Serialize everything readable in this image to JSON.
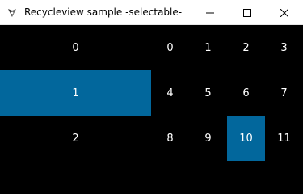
{
  "window": {
    "title": "Recycleview sample -selectable-",
    "icon": "kivy-app-icon",
    "buttons": [
      "minimize-icon",
      "maximize-icon",
      "close-icon"
    ]
  },
  "left_list": {
    "items": [
      {
        "label": "0",
        "selected": false
      },
      {
        "label": "1",
        "selected": true
      },
      {
        "label": "2",
        "selected": false
      }
    ]
  },
  "grid": {
    "items": [
      {
        "label": "0",
        "selected": false
      },
      {
        "label": "1",
        "selected": false
      },
      {
        "label": "2",
        "selected": false
      },
      {
        "label": "3",
        "selected": false
      },
      {
        "label": "4",
        "selected": false
      },
      {
        "label": "5",
        "selected": false
      },
      {
        "label": "6",
        "selected": false
      },
      {
        "label": "7",
        "selected": false
      },
      {
        "label": "8",
        "selected": false
      },
      {
        "label": "9",
        "selected": false
      },
      {
        "label": "10",
        "selected": true
      },
      {
        "label": "11",
        "selected": false
      }
    ]
  },
  "colors": {
    "selected": "#02679c",
    "background": "#000000",
    "text": "#ffffff"
  }
}
